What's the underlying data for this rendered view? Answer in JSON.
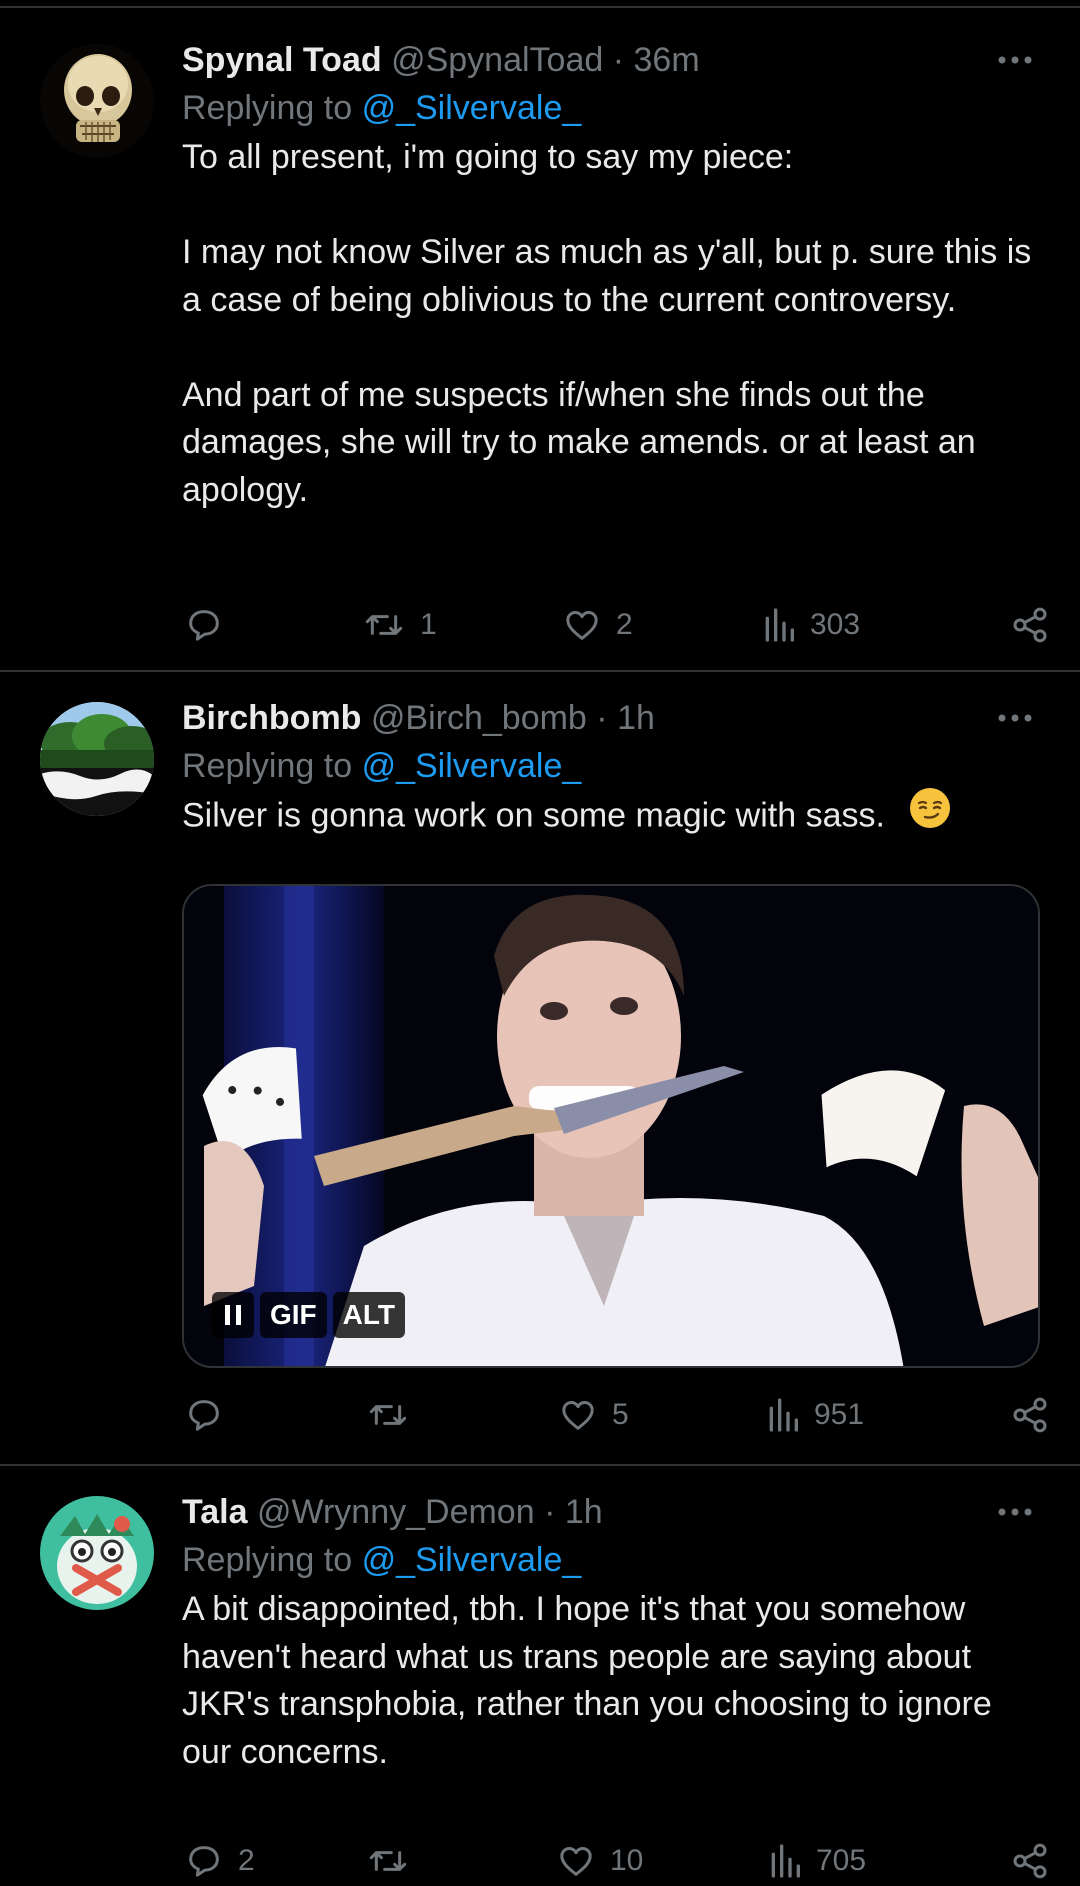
{
  "tweets": [
    {
      "name": "Spynal Toad",
      "handle": "@SpynalToad",
      "separator": "·",
      "time": "36m",
      "replying_prefix": "Replying to",
      "replying_to": "@_Silvervale_",
      "paragraphs": [
        "To all present, i'm going to say my piece:",
        "I may not know Silver as much as y'all, but p. sure this is a case of being oblivious to the current controversy.",
        "And part of me suspects if/when she finds out the damages, she will try to make amends. or at least an apology."
      ],
      "replies": "",
      "retweets": "1",
      "likes": "2",
      "views": "303",
      "avatar_icon": "skull-avatar"
    },
    {
      "name": "Birchbomb",
      "handle": "@Birch_bomb",
      "separator": "·",
      "time": "1h",
      "replying_prefix": "Replying to",
      "replying_to": "@_Silvervale_",
      "text": "Silver is gonna work on some magic with sass.",
      "emoji": "smirking-face-emoji",
      "media_badges": {
        "gif": "GIF",
        "alt": "ALT"
      },
      "replies": "",
      "retweets": "",
      "likes": "5",
      "views": "951",
      "avatar_icon": "tree-landscape-avatar"
    },
    {
      "name": "Tala",
      "handle": "@Wrynny_Demon",
      "separator": "·",
      "time": "1h",
      "replying_prefix": "Replying to",
      "replying_to": "@_Silvervale_",
      "text": "A bit disappointed, tbh. I hope it's that you somehow haven't heard what us trans people are saying about JKR's transphobia, rather than you choosing to ignore our concerns.",
      "replies": "2",
      "retweets": "",
      "likes": "10",
      "views": "705",
      "avatar_icon": "green-creature-avatar"
    }
  ],
  "colors": {
    "background": "#000000",
    "text": "#e7e9ea",
    "muted": "#71767b",
    "link": "#1d9bf0",
    "divider": "#2f3336"
  }
}
